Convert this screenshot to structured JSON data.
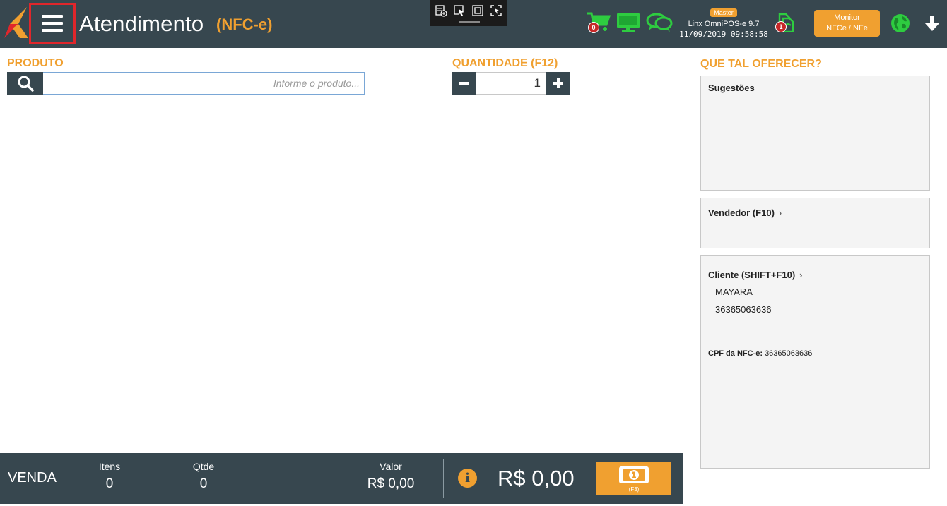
{
  "header": {
    "title": "Atendimento",
    "subtitle": "(NFC-e)",
    "cart_count": "0",
    "sync_count": "1",
    "environment_badge": "Master",
    "system_name": "Linx OmniPOS-e  9.7",
    "datetime": "11/09/2019 09:58:58",
    "monitor_line1": "Monitor",
    "monitor_line2": "NFCe / NFe"
  },
  "produto": {
    "label": "PRODUTO",
    "placeholder": "Informe o produto..."
  },
  "quantidade": {
    "label": "QUANTIDADE (F12)",
    "value": "1"
  },
  "sidebar": {
    "heading": "QUE TAL OFERECER?",
    "sugestoes_title": "Sugestões",
    "vendedor_title": "Vendedor (F10)",
    "cliente_title": "Cliente (SHIFT+F10)",
    "cliente_name": "MAYARA",
    "cliente_doc": "36365063636",
    "cpf_label": "CPF da NFC-e:",
    "cpf_value": "36365063636"
  },
  "footer": {
    "venda_label": "VENDA",
    "itens_label": "Itens",
    "itens_value": "0",
    "qtde_label": "Qtde",
    "qtde_value": "0",
    "valor_label": "Valor",
    "valor_value": "R$ 0,00",
    "total": "R$ 0,00",
    "pay_hotkey": "(F3)"
  },
  "colors": {
    "header_bg": "#37474f",
    "accent": "#f0a030",
    "green": "#2ecc40",
    "menu_highlight": "#e0262b"
  },
  "icons": {
    "menu": "hamburger-icon",
    "search": "search-icon",
    "cart": "cart-icon",
    "monitor": "monitor-icon",
    "chat": "chat-icon",
    "sync": "sync-files-icon",
    "globe": "globe-icon",
    "download": "arrow-down-icon",
    "info": "info-icon",
    "cash": "cash-icon"
  }
}
